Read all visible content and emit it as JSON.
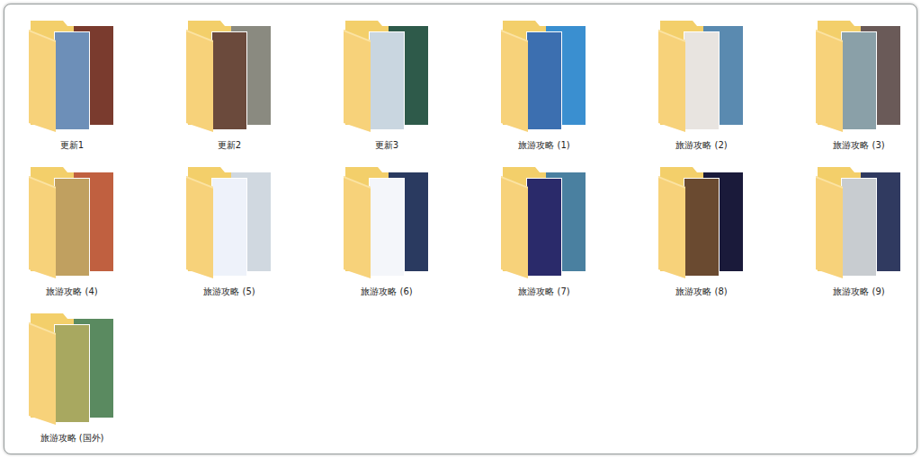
{
  "folders": [
    {
      "label": "更新1",
      "selected": false,
      "colors": [
        "#6d8fb8",
        "#7a3b2e"
      ]
    },
    {
      "label": "更新2",
      "selected": false,
      "colors": [
        "#6b4a3c",
        "#8a8a80"
      ]
    },
    {
      "label": "更新3",
      "selected": false,
      "colors": [
        "#c9d6e0",
        "#2e5a4a"
      ]
    },
    {
      "label": "旅游攻略 (1)",
      "selected": false,
      "colors": [
        "#3c6fb0",
        "#3a8fd0"
      ]
    },
    {
      "label": "旅游攻略 (2)",
      "selected": false,
      "colors": [
        "#e8e4e0",
        "#5a8ab0"
      ]
    },
    {
      "label": "旅游攻略 (3)",
      "selected": false,
      "colors": [
        "#8aa0a8",
        "#6a5a58"
      ]
    },
    {
      "label": "旅游攻略 (4)",
      "selected": false,
      "colors": [
        "#c0a060",
        "#c06040"
      ]
    },
    {
      "label": "旅游攻略 (5)",
      "selected": false,
      "colors": [
        "#eef2fa",
        "#d0d8e0"
      ]
    },
    {
      "label": "旅游攻略 (6)",
      "selected": false,
      "colors": [
        "#f4f6fa",
        "#2a3a60"
      ]
    },
    {
      "label": "旅游攻略 (7)",
      "selected": false,
      "colors": [
        "#2a2a6a",
        "#4a80a0"
      ]
    },
    {
      "label": "旅游攻略 (8)",
      "selected": false,
      "colors": [
        "#6a4a30",
        "#1a1a3a"
      ]
    },
    {
      "label": "旅游攻略 (9)",
      "selected": false,
      "colors": [
        "#c8ccd0",
        "#303a60"
      ]
    },
    {
      "label": "旅游攻略 (国外)",
      "selected": false,
      "colors": [
        "#a8a860",
        "#5a8a60"
      ]
    }
  ]
}
